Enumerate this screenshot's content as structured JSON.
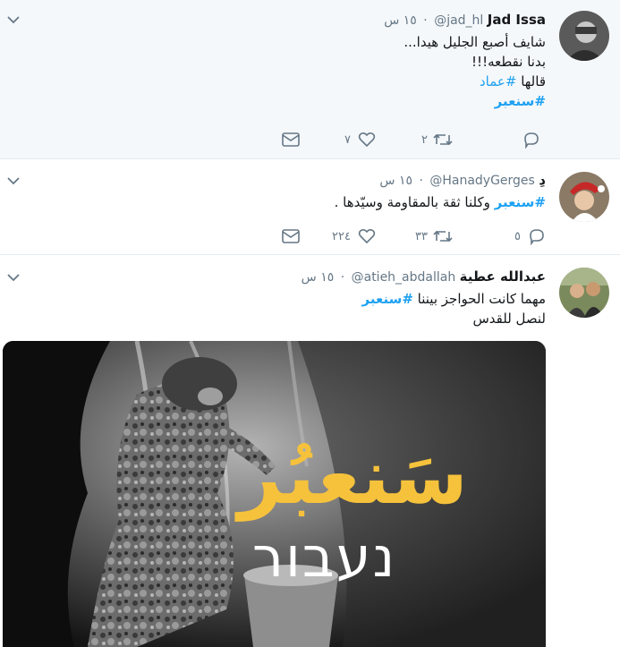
{
  "tweets": [
    {
      "name": "Jad Issa",
      "handle": "@jad_hl",
      "time": "١٥ س",
      "lines": [
        "شايف أصبع الجليل هيدا...",
        "بدنا نقطعه!!!"
      ],
      "line3_prefix": "قالها ",
      "line3_hashtag": "#عماد",
      "line4_hashtag": "#سنعبر",
      "retweets": "٢",
      "likes": "٧",
      "replies": ""
    },
    {
      "name": "دِ",
      "handle": "@HanadyGerges",
      "time": "١٥ س",
      "hashtag": "#سنعبر",
      "rest": " وكلنا ثقة بالمقاومة وسيّدها .",
      "replies": "٥",
      "retweets": "٣٣",
      "likes": "٢٢٤"
    },
    {
      "name": "عبدالله عطية",
      "handle": "@atieh_abdallah",
      "time": "١٥ س",
      "prefix": "مهما كانت الحواجز بيننا ",
      "hashtag": "#سنعبر",
      "line2": "لنصل للقدس",
      "image_text_arabic": "سَنعبُر",
      "image_text_hebrew": "נעבור"
    }
  ],
  "colors": {
    "accent": "#1da1f2",
    "highlight_bg": "#f5f8fa",
    "muted": "#657786",
    "image_title": "#f6c23c"
  },
  "icons": [
    "chevron-down-icon",
    "reply-icon",
    "retweet-icon",
    "like-icon",
    "message-icon"
  ]
}
